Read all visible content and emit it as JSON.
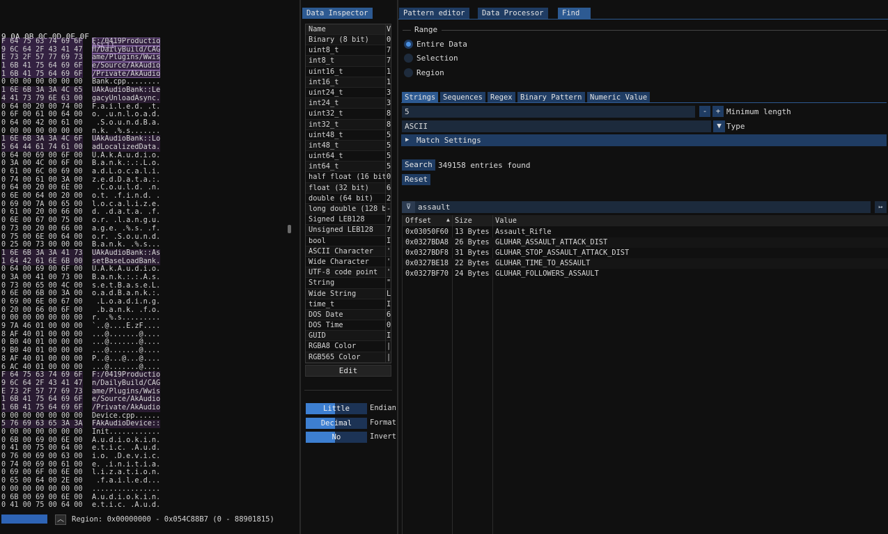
{
  "hex": {
    "header_bytes": "9 0A 0B 0C 0D 0E 0F",
    "header_ascii": "ASCII",
    "rows": [
      [
        "F 64 75 63 74 69 6F",
        "F:/0419Productio",
        "sel"
      ],
      [
        "9 6C 64 2F 43 41 47",
        "n/DailyBuild/CAG",
        "sel"
      ],
      [
        "E 73 2F 57 77 69 73",
        "ame/Plugins/Wwis",
        "sel"
      ],
      [
        "1 6B 41 75 64 69 6F",
        "e/Source/AkAudio",
        "sel"
      ],
      [
        "1 6B 41 75 64 69 6F",
        "/Private/AkAudio",
        "sel"
      ],
      [
        "0 00 00 00 00 00 00",
        "Bank.cpp........",
        ""
      ],
      [
        "1 6E 6B 3A 3A 4C 65",
        "UAkAudioBank::Le",
        "lo"
      ],
      [
        "4 41 73 79 6E 63 00",
        "gacyUnloadAsync.",
        "lo"
      ],
      [
        "0 64 00 20 00 74 00",
        "F.a.i.l.e.d. .t.",
        ""
      ],
      [
        "0 6F 00 61 00 64 00",
        "o. .u.n.l.o.a.d.",
        ""
      ],
      [
        "0 64 00 42 00 61 00",
        " .S.o.u.n.d.B.a.",
        ""
      ],
      [
        "0 00 00 00 00 00 00",
        "n.k. .%.s.......",
        ""
      ],
      [
        "1 6E 6B 3A 3A 4C 6F",
        "UAkAudioBank::Lo",
        "lo"
      ],
      [
        "5 64 44 61 74 61 00",
        "adLocalizedData.",
        "lo"
      ],
      [
        "0 64 00 69 00 6F 00",
        "U.A.k.A.u.d.i.o.",
        ""
      ],
      [
        "0 3A 00 4C 00 6F 00",
        "B.a.n.k.:.:.L.o.",
        ""
      ],
      [
        "0 61 00 6C 00 69 00",
        "a.d.L.o.c.a.l.i.",
        ""
      ],
      [
        "0 74 00 61 00 3A 00",
        "z.e.d.D.a.t.a.:.",
        ""
      ],
      [
        "0 64 00 20 00 6E 00",
        " .C.o.u.l.d. .n.",
        ""
      ],
      [
        "0 6E 00 64 00 20 00",
        "o.t. .f.i.n.d. .",
        ""
      ],
      [
        "0 69 00 7A 00 65 00",
        "l.o.c.a.l.i.z.e.",
        ""
      ],
      [
        "0 61 00 20 00 66 00",
        "d. .d.a.t.a. .f.",
        ""
      ],
      [
        "0 6E 00 67 00 75 00",
        "o.r. .l.a.n.g.u.",
        ""
      ],
      [
        "0 73 00 20 00 66 00",
        "a.g.e. .%.s. .f.",
        ""
      ],
      [
        "0 75 00 6E 00 64 00",
        "o.r. .S.o.u.n.d.",
        ""
      ],
      [
        "0 25 00 73 00 00 00",
        "B.a.n.k. .%.s...",
        ""
      ],
      [
        "1 6E 6B 3A 3A 41 73",
        "UAkAudioBank::As",
        "lo"
      ],
      [
        "1 64 42 61 6E 6B 00",
        "setBaseLoadBank.",
        "lo"
      ],
      [
        "0 64 00 69 00 6F 00",
        "U.A.k.A.u.d.i.o.",
        ""
      ],
      [
        "0 3A 00 41 00 73 00",
        "B.a.n.k.:.:.A.s.",
        ""
      ],
      [
        "0 73 00 65 00 4C 00",
        "s.e.t.B.a.s.e.L.",
        ""
      ],
      [
        "0 6E 00 6B 00 3A 00",
        "o.a.d.B.a.n.k.:.",
        ""
      ],
      [
        "0 69 00 6E 00 67 00",
        " .L.o.a.d.i.n.g.",
        ""
      ],
      [
        "0 20 00 66 00 6F 00",
        " .b.a.n.k. .f.o.",
        ""
      ],
      [
        "0 00 00 00 00 00 00",
        "r. .%.s.........",
        ""
      ],
      [
        "9 7A 46 01 00 00 00",
        "`..@....E.zF....",
        ""
      ],
      [
        "8 AF 40 01 00 00 00",
        "...@.......@....",
        ""
      ],
      [
        "0 B0 40 01 00 00 00",
        "...@.......@....",
        ""
      ],
      [
        "9 B0 40 01 00 00 00",
        "...@.......@....",
        ""
      ],
      [
        "8 AF 40 01 00 00 00",
        "P..@...@...@....",
        ""
      ],
      [
        "6 AC 40 01 00 00 00",
        "...@.......@....",
        ""
      ],
      [
        "F 64 75 63 74 69 6F",
        "F:/0419Productio",
        "lo"
      ],
      [
        "9 6C 64 2F 43 41 47",
        "n/DailyBuild/CAG",
        "lo"
      ],
      [
        "E 73 2F 57 77 69 73",
        "ame/Plugins/Wwis",
        "lo"
      ],
      [
        "1 6B 41 75 64 69 6F",
        "e/Source/AkAudio",
        "lo"
      ],
      [
        "1 6B 41 75 64 69 6F",
        "/Private/AkAudio",
        "lo"
      ],
      [
        "0 00 00 00 00 00 00",
        "Device.cpp......",
        ""
      ],
      [
        "5 76 69 63 65 3A 3A",
        "FAkAudioDevice::",
        "lo"
      ],
      [
        "0 00 00 00 00 00 00",
        "Init............",
        ""
      ],
      [
        "0 6B 00 69 00 6E 00",
        "A.u.d.i.o.k.i.n.",
        ""
      ],
      [
        "0 41 00 75 00 64 00",
        "e.t.i.c. .A.u.d.",
        ""
      ],
      [
        "0 76 00 69 00 63 00",
        "i.o. .D.e.v.i.c.",
        ""
      ],
      [
        "0 74 00 69 00 61 00",
        "e. .i.n.i.t.i.a.",
        ""
      ],
      [
        "0 69 00 6F 00 6E 00",
        "l.i.z.a.t.i.o.n.",
        ""
      ],
      [
        "0 65 00 64 00 2E 00",
        " .f.a.i.l.e.d...",
        ""
      ],
      [
        "0 00 00 00 00 00 00",
        "................",
        ""
      ],
      [
        "0 6B 00 69 00 6E 00",
        "A.u.d.i.o.k.i.n.",
        ""
      ],
      [
        "0 41 00 75 00 64 00",
        "e.t.i.c. .A.u.d.",
        ""
      ]
    ],
    "footer_region": "Region: 0x00000000 - 0x054C88B7 (0 - 88901815)"
  },
  "inspector": {
    "tab": "Data Inspector",
    "col_name": "Name",
    "col_value": "V",
    "rows": [
      [
        "Binary (8 bit)",
        "0"
      ],
      [
        "uint8_t",
        "7"
      ],
      [
        "int8_t",
        "7"
      ],
      [
        "uint16_t",
        "1"
      ],
      [
        "int16_t",
        "1"
      ],
      [
        "uint24_t",
        "3"
      ],
      [
        "int24_t",
        "3"
      ],
      [
        "uint32_t",
        "8"
      ],
      [
        "int32_t",
        "8"
      ],
      [
        "uint48_t",
        "5"
      ],
      [
        "int48_t",
        "5"
      ],
      [
        "uint64_t",
        "5"
      ],
      [
        "int64_t",
        "5"
      ],
      [
        "half float (16 bit)",
        "0"
      ],
      [
        "float (32 bit)",
        "6"
      ],
      [
        "double (64 bit)",
        "2"
      ],
      [
        "long double (128 bit)",
        "-"
      ],
      [
        "Signed LEB128",
        "7"
      ],
      [
        "Unsigned LEB128",
        "7"
      ],
      [
        "bool",
        "I"
      ],
      [
        "ASCII Character",
        "'"
      ],
      [
        "Wide Character",
        "'"
      ],
      [
        "UTF-8 code point",
        "'"
      ],
      [
        "String",
        "\""
      ],
      [
        "Wide String",
        "L"
      ],
      [
        "time_t",
        "I"
      ],
      [
        "DOS Date",
        "6"
      ],
      [
        "DOS Time",
        "0"
      ],
      [
        "GUID",
        "I"
      ],
      [
        "RGBA8 Color",
        "|"
      ],
      [
        "RGB565 Color",
        "|"
      ]
    ],
    "edit_label": "Edit",
    "toggles": [
      {
        "label": "Little",
        "side": "Endian",
        "fill": 0.48
      },
      {
        "label": "Decimal",
        "side": "Format",
        "fill": 0.48
      },
      {
        "label": "No",
        "side": "Invert",
        "fill": 0.48
      }
    ]
  },
  "tabs": {
    "pattern_editor": "Pattern editor",
    "data_processor": "Data Processor",
    "find": "Find"
  },
  "find": {
    "range_title": "Range",
    "range_options": [
      "Entire Data",
      "Selection",
      "Region"
    ],
    "selected_range": "Entire Data",
    "mode_tabs": [
      "Strings",
      "Sequences",
      "Regex",
      "Binary Pattern",
      "Numeric Value"
    ],
    "active_mode": "Strings",
    "min_length_value": "5",
    "min_length_label": "Minimum length",
    "minus": "-",
    "plus": "+",
    "type_value": "ASCII",
    "type_label": "Type",
    "match_settings": "Match Settings",
    "search_label": "Search",
    "entries_found": "349158 entries found",
    "reset_label": "Reset",
    "filter_value": "assault",
    "columns": [
      "Offset",
      "Size",
      "Value"
    ],
    "results": [
      [
        "0x03050F60",
        "13 Bytes",
        "Assault_Rifle"
      ],
      [
        "0x0327BDA8",
        "26 Bytes",
        "GLUHAR_ASSAULT_ATTACK_DIST"
      ],
      [
        "0x0327BDF8",
        "31 Bytes",
        "GLUHAR_STOP_ASSAULT_ATTACK_DIST"
      ],
      [
        "0x0327BE18",
        "22 Bytes",
        "GLUHAR_TIME_TO_ASSAULT"
      ],
      [
        "0x0327BF70",
        "24 Bytes",
        "GLUHAR_FOLLOWERS_ASSAULT"
      ]
    ]
  },
  "colors": {
    "tab": "#1f3c63",
    "tab_active": "#2d5a92",
    "accent": "#3d7fd1",
    "background": "#101010"
  }
}
